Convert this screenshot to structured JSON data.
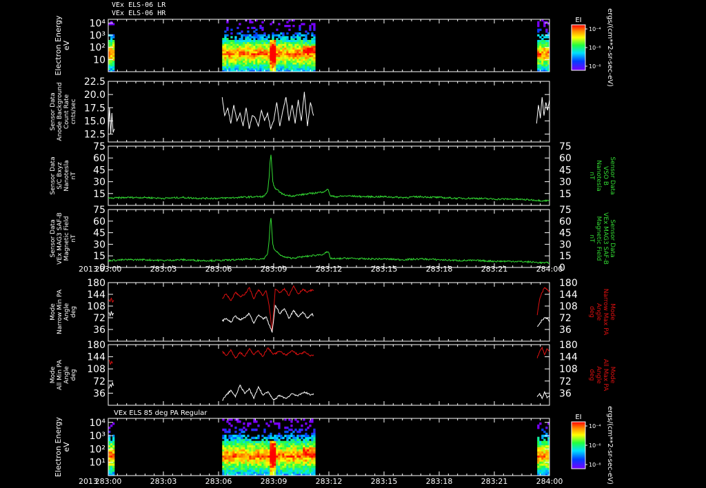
{
  "header": {
    "line1": "VEx ELS-06 LR",
    "line2": "VEx ELS-06 HR"
  },
  "time_axis": {
    "year": "2013",
    "ticks": [
      "283:00",
      "283:03",
      "283:06",
      "283:09",
      "283:12",
      "283:15",
      "283:18",
      "283:21",
      "284:00"
    ],
    "minutes": [
      0,
      180,
      360,
      540,
      720,
      900,
      1080,
      1260,
      1440
    ]
  },
  "colors": {
    "background": "#000000",
    "axis": "#ffffff",
    "green": "#33dd33",
    "red": "#e01010",
    "white": "#ffffff"
  },
  "colorbar": {
    "label": "EI",
    "unit": "ergs/(cm**2-sr-sec-eV)",
    "ticks": [
      "10⁻⁴",
      "10⁻⁶",
      "10⁻⁸"
    ]
  },
  "chart_data": [
    {
      "type": "heatmap",
      "panel_id": "p1",
      "ylabel": [
        "Electron Energy",
        "eV"
      ],
      "yscale": "log",
      "ylim": [
        1,
        20000
      ],
      "yticks": [
        [
          "10",
          10
        ],
        [
          "10²",
          100
        ],
        [
          "10³",
          1000
        ],
        [
          "10⁴",
          10000
        ]
      ],
      "coverage_minutes": [
        [
          0,
          20
        ],
        [
          372,
          670
        ],
        [
          1400,
          1440
        ]
      ],
      "peak_minute": 535,
      "feature_peak_minute": 650
    },
    {
      "type": "line",
      "panel_id": "p2",
      "ylabel": [
        "Sensor Data",
        "Anode Background",
        "Count Rate",
        "cnts/sec"
      ],
      "ylim": [
        11,
        22.5
      ],
      "yticks": [
        [
          "12.5",
          12.5
        ],
        [
          "15.0",
          15.0
        ],
        [
          "17.5",
          17.5
        ],
        [
          "20.0",
          20.0
        ],
        [
          "22.5",
          22.5
        ]
      ],
      "series": [
        {
          "color": "white",
          "x": [
            0,
            4,
            8,
            12,
            16,
            20
          ],
          "y": [
            13,
            17.5,
            12.5,
            16.5,
            12.8,
            13.5
          ]
        },
        {
          "color": "white",
          "x": [
            372,
            380,
            390,
            400,
            410,
            420,
            430,
            440,
            450,
            460,
            470,
            480,
            490,
            500,
            510,
            520,
            530,
            540,
            550,
            560,
            570,
            580,
            590,
            600,
            610,
            620,
            630,
            640,
            650,
            660,
            670
          ],
          "y": [
            19.5,
            16,
            17.5,
            14.5,
            18,
            15,
            16.5,
            14,
            17.5,
            13.5,
            16,
            15.5,
            14,
            17,
            15,
            16.5,
            13.5,
            15,
            18.5,
            14,
            17,
            19.5,
            15,
            18,
            14.5,
            19,
            15,
            20.5,
            14,
            18.5,
            16
          ]
        },
        {
          "color": "white",
          "x": [
            1398,
            1404,
            1410,
            1416,
            1422,
            1428,
            1434,
            1440
          ],
          "y": [
            14.5,
            18,
            15.5,
            19.5,
            16,
            18.5,
            17,
            19
          ]
        }
      ]
    },
    {
      "type": "line",
      "panel_id": "p3",
      "ylabel": [
        "Sensor Data",
        "S/C Bxyz",
        "Nanotesla",
        "nT"
      ],
      "ylabel_right": [
        "Sensor Data",
        "VSO B",
        "Nanotesla",
        "nT"
      ],
      "ylim": [
        0,
        75
      ],
      "yticks": [
        [
          "15",
          15
        ],
        [
          "30",
          30
        ],
        [
          "45",
          45
        ],
        [
          "60",
          60
        ],
        [
          "75",
          75
        ]
      ],
      "series": [
        {
          "color": "green",
          "x": [
            0,
            60,
            120,
            180,
            240,
            300,
            360,
            420,
            480,
            500,
            510,
            520,
            525,
            528,
            531,
            534,
            537,
            540,
            545,
            550,
            560,
            570,
            580,
            600,
            620,
            640,
            660,
            680,
            700,
            710,
            718,
            725,
            740,
            780,
            840,
            900,
            960,
            1020,
            1080,
            1140,
            1200,
            1260,
            1320,
            1380,
            1420,
            1440
          ],
          "y": [
            9,
            10,
            10,
            9,
            10,
            9,
            9,
            10,
            11,
            11,
            12,
            18,
            35,
            55,
            64,
            48,
            30,
            25,
            22,
            20,
            17,
            14,
            13,
            12,
            13,
            14,
            15,
            16,
            17,
            19,
            20,
            12,
            11,
            12,
            11,
            11,
            10,
            11,
            10,
            9,
            9,
            8,
            8,
            7,
            6,
            6
          ]
        }
      ]
    },
    {
      "type": "line",
      "panel_id": "p4",
      "ylabel": [
        "Sensor Data",
        "VEx MAG3 SAF-B",
        "Magnetic Field",
        "nT"
      ],
      "ylabel_right": [
        "Sensor Data",
        "VEx MAG3 SAF-B",
        "Magnetic Field",
        "nT"
      ],
      "ylim": [
        0,
        75
      ],
      "yticks": [
        [
          "0",
          0
        ],
        [
          "15",
          15
        ],
        [
          "30",
          30
        ],
        [
          "45",
          45
        ],
        [
          "60",
          60
        ],
        [
          "75",
          75
        ]
      ],
      "series": [
        {
          "color": "green",
          "x": [
            0,
            60,
            120,
            180,
            240,
            300,
            360,
            420,
            480,
            500,
            510,
            520,
            525,
            528,
            531,
            534,
            537,
            540,
            545,
            550,
            560,
            570,
            580,
            600,
            620,
            640,
            660,
            680,
            700,
            710,
            718,
            725,
            740,
            780,
            840,
            900,
            960,
            1020,
            1080,
            1140,
            1200,
            1260,
            1320,
            1380,
            1420,
            1440
          ],
          "y": [
            9,
            10,
            10,
            9,
            10,
            9,
            9,
            10,
            11,
            11,
            12,
            18,
            35,
            55,
            64,
            48,
            30,
            25,
            22,
            20,
            17,
            14,
            13,
            12,
            13,
            14,
            15,
            16,
            17,
            19,
            20,
            12,
            11,
            12,
            11,
            11,
            10,
            11,
            10,
            9,
            9,
            8,
            8,
            7,
            6,
            6
          ]
        }
      ]
    },
    {
      "type": "line",
      "panel_id": "p5",
      "ylabel": [
        "Mode",
        "Narrow Min PA",
        "Angle",
        "deg"
      ],
      "ylabel_right": [
        "Mode",
        "Narrow Max PA",
        "Angle",
        "deg"
      ],
      "ylim": [
        0,
        180
      ],
      "yticks": [
        [
          "36",
          36
        ],
        [
          "72",
          72
        ],
        [
          "108",
          108
        ],
        [
          "144",
          144
        ],
        [
          "180",
          180
        ]
      ],
      "series": [
        {
          "color": "red",
          "x": [
            2,
            6,
            10,
            14,
            18
          ],
          "y": [
            128,
            122,
            132,
            120,
            126
          ]
        },
        {
          "color": "white",
          "x": [
            2,
            6,
            10,
            14,
            18
          ],
          "y": [
            88,
            78,
            92,
            80,
            86
          ]
        },
        {
          "color": "red",
          "x": [
            372,
            385,
            400,
            415,
            430,
            445,
            460,
            475,
            490,
            505,
            515,
            525,
            535,
            545,
            560,
            575,
            590,
            605,
            620,
            635,
            650,
            665,
            670
          ],
          "y": [
            132,
            145,
            125,
            150,
            138,
            142,
            165,
            130,
            158,
            140,
            155,
            110,
            30,
            160,
            150,
            162,
            140,
            170,
            145,
            160,
            150,
            158,
            155
          ]
        },
        {
          "color": "white",
          "x": [
            372,
            385,
            400,
            415,
            430,
            445,
            460,
            475,
            490,
            505,
            515,
            525,
            535,
            545,
            560,
            575,
            590,
            605,
            620,
            635,
            650,
            665,
            670
          ],
          "y": [
            62,
            70,
            58,
            78,
            65,
            72,
            85,
            55,
            80,
            68,
            75,
            50,
            28,
            110,
            85,
            100,
            70,
            95,
            75,
            90,
            70,
            85,
            78
          ]
        },
        {
          "color": "red",
          "x": [
            1400,
            1408,
            1416,
            1424,
            1432,
            1440
          ],
          "y": [
            80,
            130,
            150,
            165,
            160,
            150
          ]
        },
        {
          "color": "white",
          "x": [
            1400,
            1408,
            1416,
            1424,
            1432,
            1440
          ],
          "y": [
            45,
            55,
            65,
            72,
            70,
            60
          ]
        }
      ]
    },
    {
      "type": "line",
      "panel_id": "p6",
      "ylabel": [
        "Mode",
        "All Min PA",
        "Angle",
        "deg"
      ],
      "ylabel_right": [
        "Mode",
        "All Max PA",
        "Angle",
        "deg"
      ],
      "ylim": [
        0,
        180
      ],
      "yticks": [
        [
          "36",
          36
        ],
        [
          "72",
          72
        ],
        [
          "108",
          108
        ],
        [
          "144",
          144
        ],
        [
          "180",
          180
        ]
      ],
      "series": [
        {
          "color": "red",
          "x": [
            3,
            7,
            11,
            15
          ],
          "y": [
            135,
            122,
            130,
            125
          ]
        },
        {
          "color": "white",
          "x": [
            2,
            6,
            10,
            14,
            18
          ],
          "y": [
            50,
            62,
            55,
            68,
            58
          ]
        },
        {
          "color": "red",
          "x": [
            372,
            385,
            400,
            415,
            430,
            445,
            460,
            475,
            490,
            505,
            520,
            540,
            560,
            580,
            600,
            620,
            640,
            660,
            670
          ],
          "y": [
            160,
            148,
            165,
            140,
            158,
            145,
            168,
            150,
            162,
            145,
            170,
            152,
            160,
            148,
            162,
            150,
            158,
            146,
            150
          ]
        },
        {
          "color": "white",
          "x": [
            372,
            385,
            400,
            415,
            430,
            445,
            460,
            475,
            490,
            505,
            520,
            540,
            560,
            580,
            600,
            620,
            640,
            660,
            670
          ],
          "y": [
            15,
            30,
            45,
            25,
            60,
            35,
            50,
            20,
            55,
            30,
            40,
            15,
            30,
            20,
            35,
            28,
            40,
            30,
            35
          ]
        },
        {
          "color": "red",
          "x": [
            1400,
            1408,
            1416,
            1424,
            1432,
            1440
          ],
          "y": [
            140,
            160,
            172,
            150,
            168,
            160
          ]
        },
        {
          "color": "white",
          "x": [
            1400,
            1408,
            1416,
            1424,
            1432,
            1440
          ],
          "y": [
            25,
            35,
            20,
            40,
            22,
            30
          ]
        }
      ]
    },
    {
      "type": "heatmap",
      "panel_id": "p7",
      "title": "VEx ELS 85 deg PA Regular",
      "ylabel": [
        "Electron Energy",
        "eV"
      ],
      "yscale": "log",
      "ylim": [
        1,
        20000
      ],
      "yticks": [
        [
          "10¹",
          10
        ],
        [
          "10²",
          100
        ],
        [
          "10³",
          1000
        ],
        [
          "10⁴",
          10000
        ]
      ],
      "coverage_minutes": [
        [
          0,
          20
        ],
        [
          372,
          670
        ],
        [
          1400,
          1440
        ]
      ],
      "peak_minute": 535,
      "feature_peak_minute": 650
    }
  ]
}
